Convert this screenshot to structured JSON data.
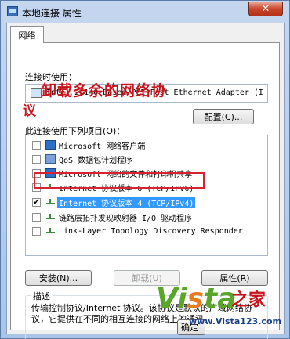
{
  "window": {
    "title": "本地连接 属性",
    "close_glyph": "✕"
  },
  "tabs": [
    {
      "label": "网络"
    }
  ],
  "connect_using": {
    "label": "连接时使用：",
    "adapter_name": "Intel 21140-Based PCI Fast Ethernet Adapter (I"
  },
  "configure_button": "配置(C)...",
  "items_label": "此连接使用下列项目(O)：",
  "items": [
    {
      "checked": false,
      "icon": "network-client-icon",
      "label": "Microsoft 网络客户端"
    },
    {
      "checked": false,
      "icon": "qos-scheduler-icon",
      "label": "QoS 数据包计划程序"
    },
    {
      "checked": false,
      "icon": "file-printer-sharing-icon",
      "label": "Microsoft 网络的文件和打印机共享"
    },
    {
      "checked": false,
      "icon": "protocol-icon",
      "label": "Internet 协议版本 6 (TCP/IPv6)"
    },
    {
      "checked": true,
      "icon": "protocol-icon",
      "label": "Internet 协议版本 4 (TCP/IPv4)",
      "selected": true
    },
    {
      "checked": false,
      "icon": "protocol-icon",
      "label": "链路层拓扑发现映射器 I/O 驱动程序"
    },
    {
      "checked": false,
      "icon": "protocol-icon",
      "label": "Link-Layer Topology Discovery Responder"
    }
  ],
  "buttons": {
    "install": "安装(N)...",
    "uninstall": "卸载(U)",
    "properties": "属性(R)",
    "ok_partial": "确定"
  },
  "description": {
    "title": "描述",
    "text": "传输控制协议/Internet 协议。该协议是默认的广域网络协议，它提供在不同的相互连接的网络上的通讯。"
  },
  "annotation": {
    "line1": "卸载多余的网络协",
    "line2": "议"
  },
  "watermark": {
    "logo_v": "Vi",
    "logo_s": "s",
    "logo_ta": "ta",
    "zhijia": "之家",
    "url": "www.Vista123.com"
  },
  "colors": {
    "annotation_red": "#c8141c",
    "selection_blue": "#3399ff",
    "highlight_border": "#d6232f"
  }
}
